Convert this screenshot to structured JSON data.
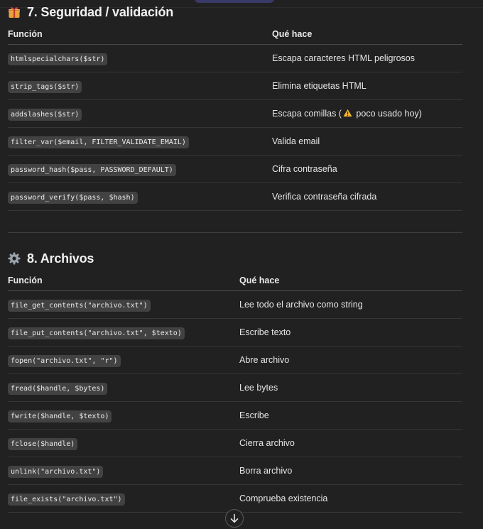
{
  "section7": {
    "title": "7. Seguridad / validación",
    "icon": "gift-box-icon",
    "columns": [
      "Función",
      "Qué hace"
    ],
    "rows": [
      {
        "code": "htmlspecialchars($str)",
        "desc": "Escapa caracteres HTML peligrosos"
      },
      {
        "code": "strip_tags($str)",
        "desc": "Elimina etiquetas HTML"
      },
      {
        "code": "addslashes($str)",
        "desc_pre": "Escapa comillas (",
        "desc_post": " poco usado hoy)",
        "inline_icon": "warning-icon"
      },
      {
        "code": "filter_var($email, FILTER_VALIDATE_EMAIL)",
        "desc": "Valida email"
      },
      {
        "code": "password_hash($pass, PASSWORD_DEFAULT)",
        "desc": "Cifra contraseña"
      },
      {
        "code": "password_verify($pass, $hash)",
        "desc": "Verifica contraseña cifrada"
      }
    ]
  },
  "section8": {
    "title": "8. Archivos",
    "icon": "gear-icon",
    "columns": [
      "Función",
      "Qué hace"
    ],
    "rows": [
      {
        "code": "file_get_contents(\"archivo.txt\")",
        "desc": "Lee todo el archivo como string"
      },
      {
        "code": "file_put_contents(\"archivo.txt\", $texto)",
        "desc": "Escribe texto"
      },
      {
        "code": "fopen(\"archivo.txt\", \"r\")",
        "desc": "Abre archivo"
      },
      {
        "code": "fread($handle, $bytes)",
        "desc": "Lee bytes"
      },
      {
        "code": "fwrite($handle, $texto)",
        "desc": "Escribe"
      },
      {
        "code": "fclose($handle)",
        "desc": "Cierra archivo"
      },
      {
        "code": "unlink(\"archivo.txt\")",
        "desc": "Borra archivo"
      },
      {
        "code": "file_exists(\"archivo.txt\")",
        "desc": "Comprueba existencia"
      }
    ]
  },
  "scroll_button": {
    "icon": "arrow-down-icon"
  },
  "colors": {
    "background": "#212121",
    "code_bg": "#424242",
    "text": "#ececec",
    "warning": "#f5b731"
  }
}
